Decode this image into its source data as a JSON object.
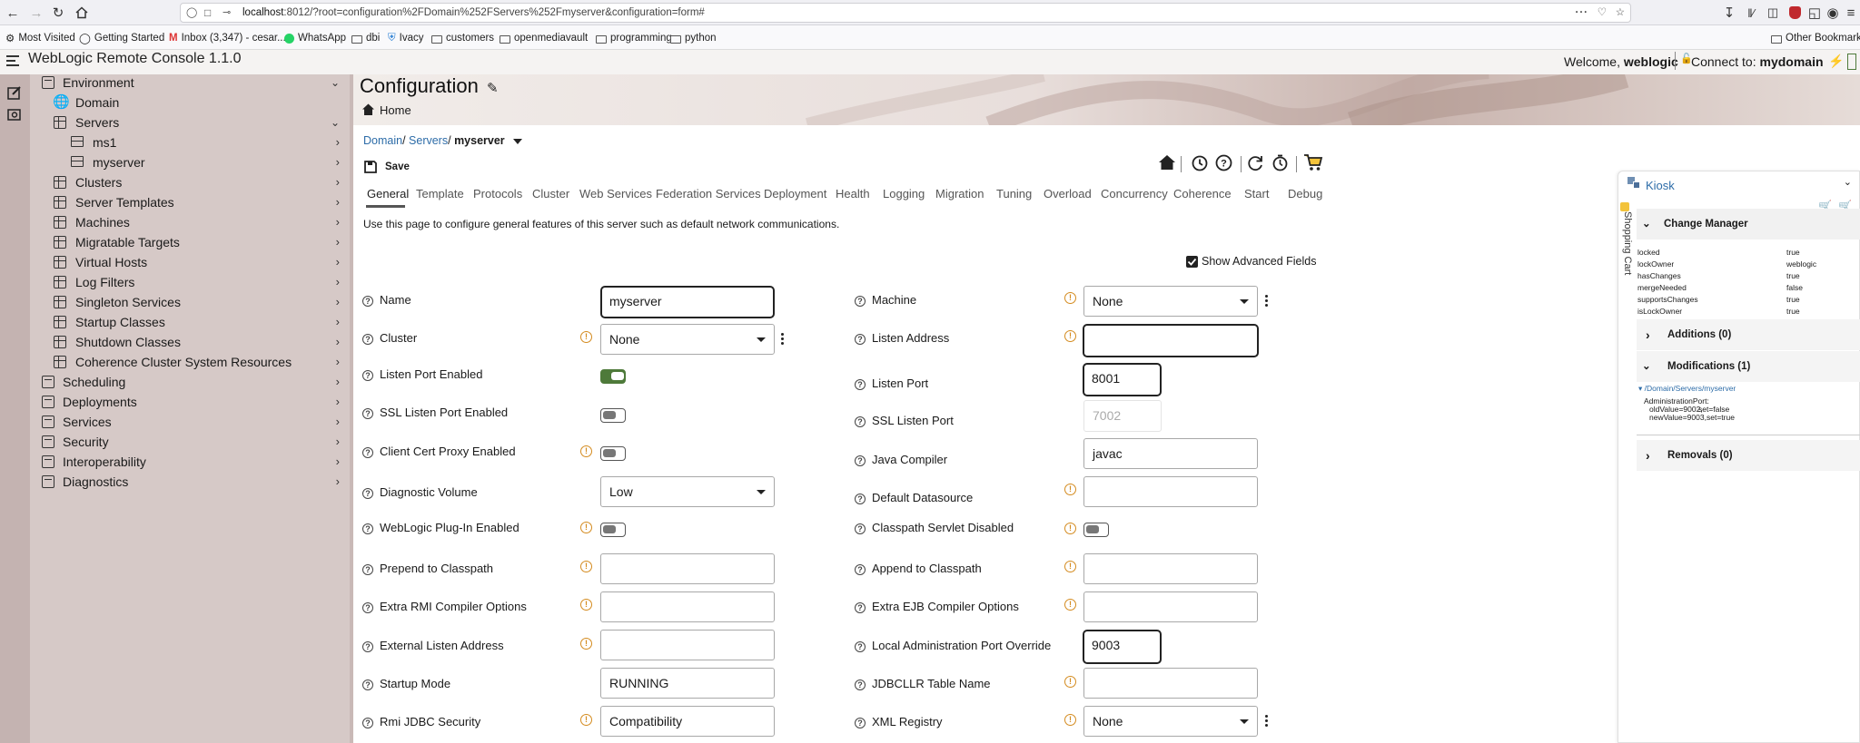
{
  "browser": {
    "url_host": "localhost",
    "url_rest": ":8012/?root=configuration%2FDomain%252FServers%252Fmyserver&configuration=form#",
    "bookmarks": [
      "Most Visited",
      "Getting Started",
      "Inbox (3,347) - cesar...",
      "WhatsApp",
      "dbi",
      "Ivacy",
      "customers",
      "openmediavault",
      "programming",
      "python"
    ],
    "other_bookmarks": "Other Bookmarks"
  },
  "app": {
    "title": "WebLogic Remote Console 1.1.0",
    "welcome_prefix": "Welcome, ",
    "user": "weblogic",
    "connect_prefix": "Connect to: ",
    "domain": "mydomain"
  },
  "nav": {
    "environment": "Environment",
    "domain": "Domain",
    "servers": "Servers",
    "ms1": "ms1",
    "myserver": "myserver",
    "clusters": "Clusters",
    "server_templates": "Server Templates",
    "machines": "Machines",
    "migratable_targets": "Migratable Targets",
    "virtual_hosts": "Virtual Hosts",
    "log_filters": "Log Filters",
    "singleton_services": "Singleton Services",
    "startup_classes": "Startup Classes",
    "shutdown_classes": "Shutdown Classes",
    "coherence": "Coherence Cluster System Resources",
    "scheduling": "Scheduling",
    "deployments": "Deployments",
    "services": "Services",
    "security": "Security",
    "interoperability": "Interoperability",
    "diagnostics": "Diagnostics"
  },
  "page": {
    "title": "Configuration",
    "home": "Home",
    "crumb_domain": "Domain",
    "crumb_servers": "Servers",
    "crumb_current": "myserver",
    "save": "Save",
    "description": "Use this page to configure general features of this server such as default network communications.",
    "show_advanced": "Show Advanced Fields"
  },
  "tabs": [
    "General",
    "Template",
    "Protocols",
    "Cluster",
    "Web Services",
    "Federation Services",
    "Deployment",
    "Health",
    "Logging",
    "Migration",
    "Tuning",
    "Overload",
    "Concurrency",
    "Coherence",
    "Start",
    "Debug"
  ],
  "form": {
    "name_label": "Name",
    "name_value": "myserver",
    "cluster_label": "Cluster",
    "cluster_value": "None",
    "listen_port_enabled_label": "Listen Port Enabled",
    "listen_port_enabled": true,
    "ssl_enabled_label": "SSL Listen Port Enabled",
    "ssl_enabled": false,
    "client_cert_label": "Client Cert Proxy Enabled",
    "client_cert": false,
    "diag_volume_label": "Diagnostic Volume",
    "diag_volume_value": "Low",
    "plugin_label": "WebLogic Plug-In Enabled",
    "plugin": false,
    "prepend_label": "Prepend to Classpath",
    "prepend_value": "",
    "rmi_opts_label": "Extra RMI Compiler Options",
    "rmi_opts_value": "",
    "ext_listen_label": "External Listen Address",
    "ext_listen_value": "",
    "startup_mode_label": "Startup Mode",
    "startup_mode_value": "RUNNING",
    "rmi_jdbc_label": "Rmi JDBC Security",
    "rmi_jdbc_value": "Compatibility",
    "machine_label": "Machine",
    "machine_value": "None",
    "listen_addr_label": "Listen Address",
    "listen_addr_value": "",
    "listen_port_label": "Listen Port",
    "listen_port_value": "8001",
    "ssl_port_label": "SSL Listen Port",
    "ssl_port_value": "7002",
    "java_compiler_label": "Java Compiler",
    "java_compiler_value": "javac",
    "default_ds_label": "Default Datasource",
    "default_ds_value": "",
    "cp_servlet_label": "Classpath Servlet Disabled",
    "cp_servlet": false,
    "append_label": "Append to Classpath",
    "append_value": "",
    "ejb_opts_label": "Extra EJB Compiler Options",
    "ejb_opts_value": "",
    "local_admin_label": "Local Administration Port Override",
    "local_admin_value": "9003",
    "jdbcllr_label": "JDBCLLR Table Name",
    "jdbcllr_value": "",
    "xml_registry_label": "XML Registry",
    "xml_registry_value": "None"
  },
  "kiosk": {
    "title": "Kiosk",
    "side_label": "Shopping Cart",
    "change_manager": "Change Manager",
    "props": [
      {
        "k": "locked",
        "v": "true"
      },
      {
        "k": "lockOwner",
        "v": "weblogic"
      },
      {
        "k": "hasChanges",
        "v": "true"
      },
      {
        "k": "mergeNeeded",
        "v": "false"
      },
      {
        "k": "supportsChanges",
        "v": "true"
      },
      {
        "k": "isLockOwner",
        "v": "true"
      }
    ],
    "additions": "Additions (0)",
    "modifications": "Modifications (1)",
    "mod_path": "/Domain/Servers/myserver",
    "mod_attr": "AdministrationPort:",
    "mod_old": "oldValue=9002,",
    "mod_old_set": "set=false",
    "mod_new": "newValue=9003,",
    "mod_new_set": "set=true",
    "removals": "Removals (0)"
  }
}
